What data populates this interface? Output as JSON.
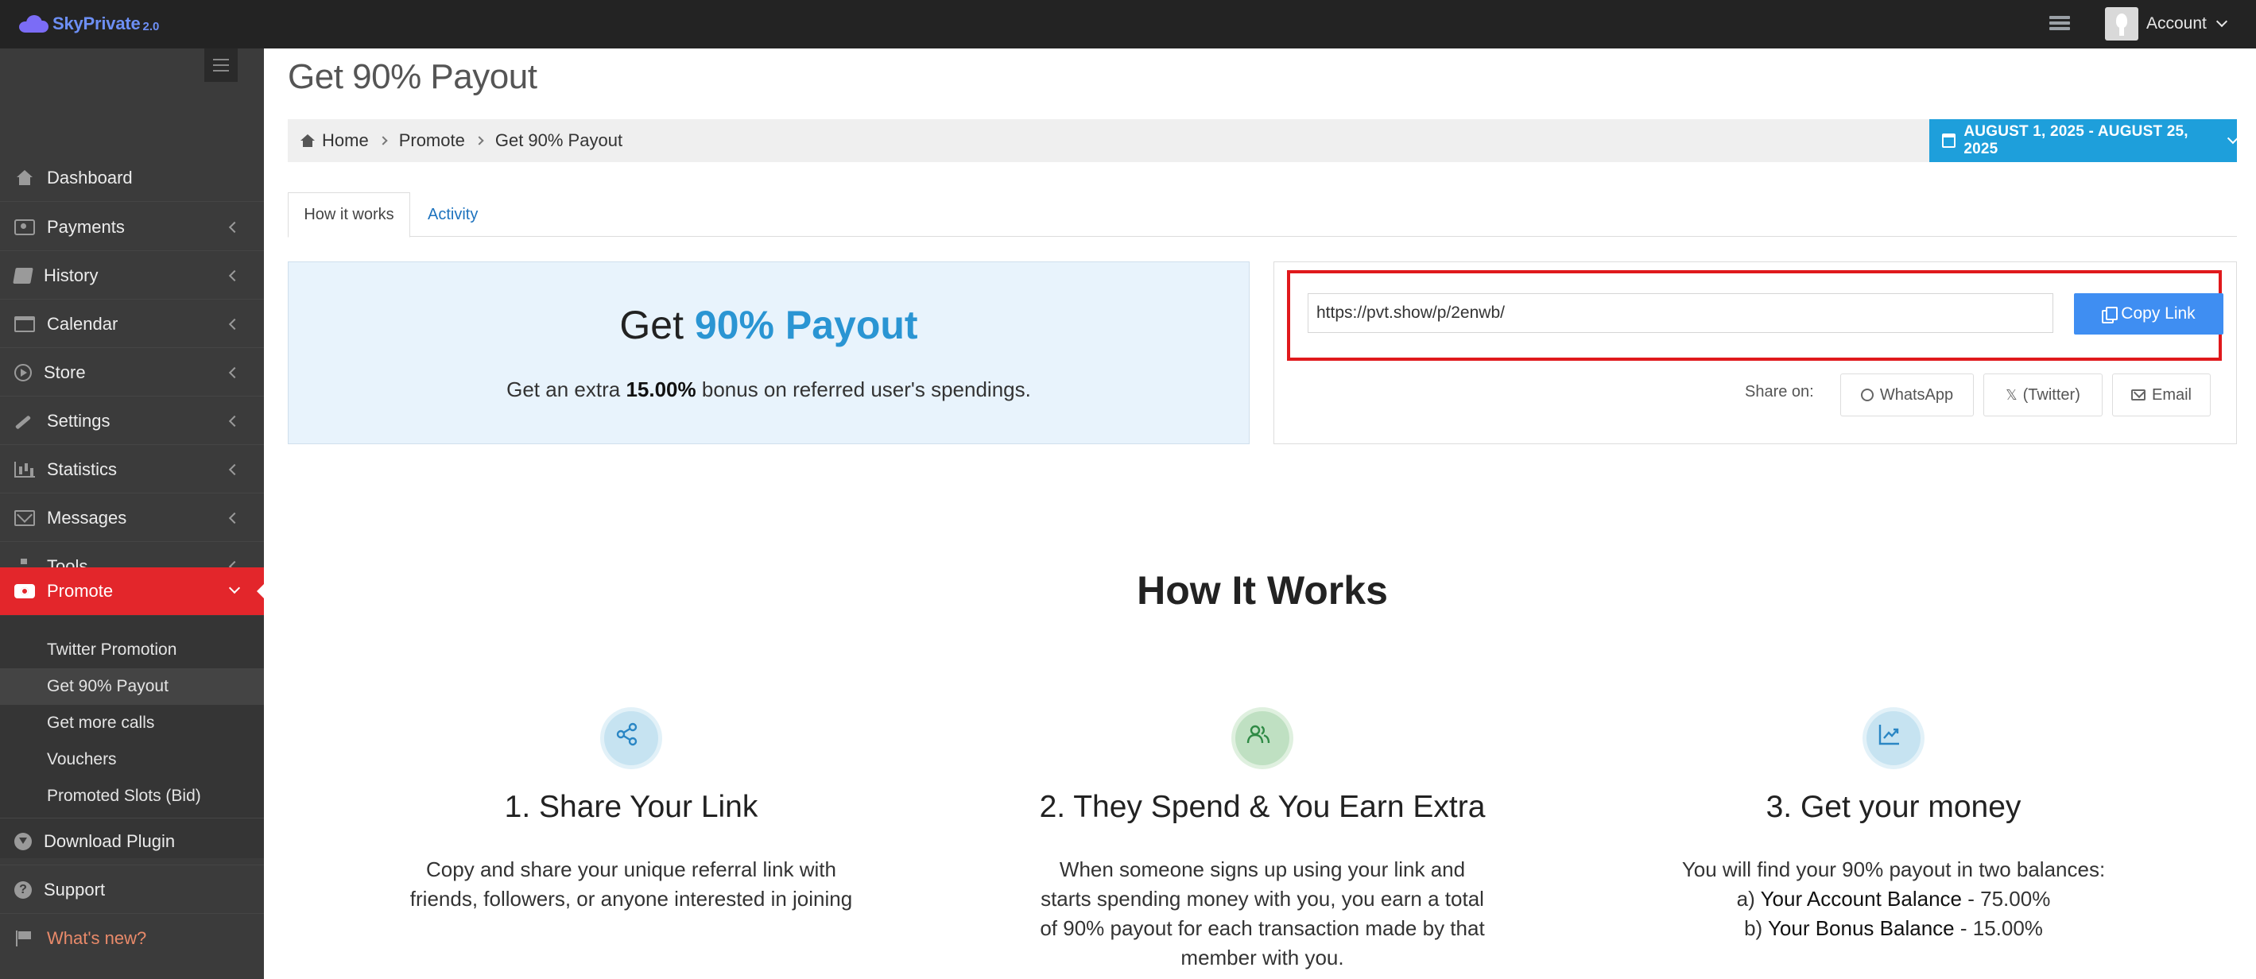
{
  "brand": {
    "name": "SkyPrivate",
    "version": "2.0"
  },
  "topbar": {
    "account_label": "Account"
  },
  "sidebar": {
    "items": [
      {
        "label": "Dashboard"
      },
      {
        "label": "Payments"
      },
      {
        "label": "History"
      },
      {
        "label": "Calendar"
      },
      {
        "label": "Store"
      },
      {
        "label": "Settings"
      },
      {
        "label": "Statistics"
      },
      {
        "label": "Messages"
      },
      {
        "label": "Tools"
      },
      {
        "label": "Promote"
      }
    ],
    "promote_sub": [
      {
        "label": "Twitter Promotion"
      },
      {
        "label": "Get 90% Payout"
      },
      {
        "label": "Get more calls"
      },
      {
        "label": "Vouchers"
      },
      {
        "label": "Promoted Slots (Bid)"
      }
    ],
    "bottom": [
      {
        "label": "Download Plugin"
      },
      {
        "label": "Support"
      },
      {
        "label": "What's new?"
      }
    ]
  },
  "page": {
    "title": "Get 90% Payout"
  },
  "breadcrumb": {
    "home": "Home",
    "section": "Promote",
    "current": "Get 90% Payout"
  },
  "date_range": {
    "label": "AUGUST 1, 2025 - AUGUST 25, 2025"
  },
  "tabs": [
    {
      "label": "How it works"
    },
    {
      "label": "Activity"
    }
  ],
  "promo": {
    "title_prefix": "Get",
    "title_highlight": "90% Payout",
    "subtitle_prefix": "Get an extra",
    "subtitle_value": "15.00%",
    "subtitle_suffix": "bonus on referred user's spendings."
  },
  "referral": {
    "link": "https://pvt.show/p/2enwb/",
    "copy_label": "Copy Link",
    "share_on_label": "Share on:",
    "share_whatsapp": "WhatsApp",
    "share_twitter": "(Twitter)",
    "share_email": "Email"
  },
  "how_it_works": {
    "title": "How It Works",
    "steps": [
      {
        "title": "1. Share Your Link",
        "line1": "Copy and share your unique referral link with",
        "line2": "friends, followers, or anyone interested in joining"
      },
      {
        "title": "2. They Spend & You Earn Extra",
        "line1": "When someone signs up using your link and",
        "line2": "starts spending money with you, you earn a total",
        "line3": "of 90% payout for each transaction made by that",
        "line4": "member with you."
      },
      {
        "title": "3. Get your money",
        "line1": "You will find your 90% payout in two balances:",
        "a_prefix": "a)",
        "a_label": "Your Account Balance",
        "a_value": "- 75.00%",
        "b_prefix": "b)",
        "b_label": "Your Bonus Balance",
        "b_value": "- 15.00%"
      }
    ]
  },
  "colors": {
    "topbar": "#232323",
    "sidebar": "#3b3b3b",
    "active_nav": "#e3262b",
    "accent_blue": "#1e9fdb",
    "copy_button": "#3f8ef2",
    "highlight_frame": "#e0191c"
  }
}
